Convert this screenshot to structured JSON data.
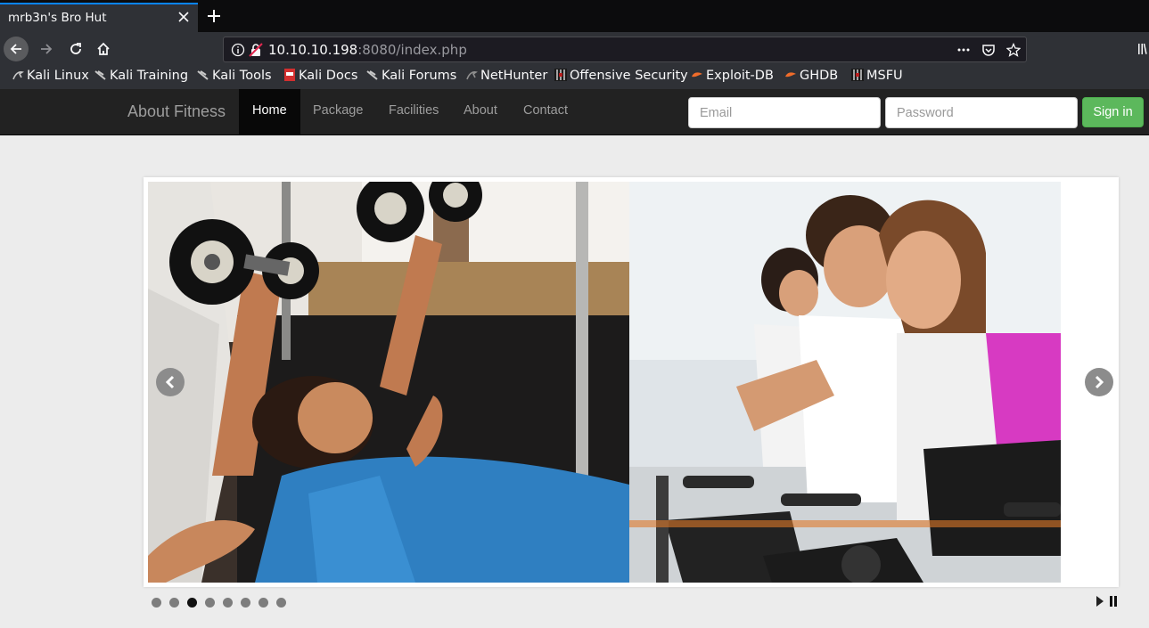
{
  "browser": {
    "tab_title": "mrb3n's Bro Hut",
    "url_host": "10.10.10.198",
    "url_rest": ":8080/index.php",
    "bookmarks": [
      {
        "label": "Kali Linux",
        "icon": "kali-dragon-icon"
      },
      {
        "label": "Kali Training",
        "icon": "kali-dragon-icon"
      },
      {
        "label": "Kali Tools",
        "icon": "kali-dragon-icon"
      },
      {
        "label": "Kali Docs",
        "icon": "kali-docs-icon"
      },
      {
        "label": "Kali Forums",
        "icon": "kali-dragon-icon"
      },
      {
        "label": "NetHunter",
        "icon": "nethunter-icon"
      },
      {
        "label": "Offensive Security",
        "icon": "offsec-icon"
      },
      {
        "label": "Exploit-DB",
        "icon": "exploitdb-icon"
      },
      {
        "label": "GHDB",
        "icon": "exploitdb-icon"
      },
      {
        "label": "MSFU",
        "icon": "offsec-icon"
      }
    ]
  },
  "site": {
    "brand": "About Fitness",
    "nav": [
      "Home",
      "Package",
      "Facilities",
      "About",
      "Contact"
    ],
    "active_nav": "Home",
    "email_placeholder": "Email",
    "password_placeholder": "Password",
    "signin_label": "Sign in"
  },
  "carousel": {
    "slide_count": 8,
    "active_slide": 3,
    "images": [
      "woman-lifting-dumbbells-with-trainer",
      "people-on-exercise-bikes"
    ]
  },
  "colors": {
    "accent_tab": "#0a84ff",
    "signin_button": "#5cb85c",
    "site_nav_bg": "#222222"
  }
}
